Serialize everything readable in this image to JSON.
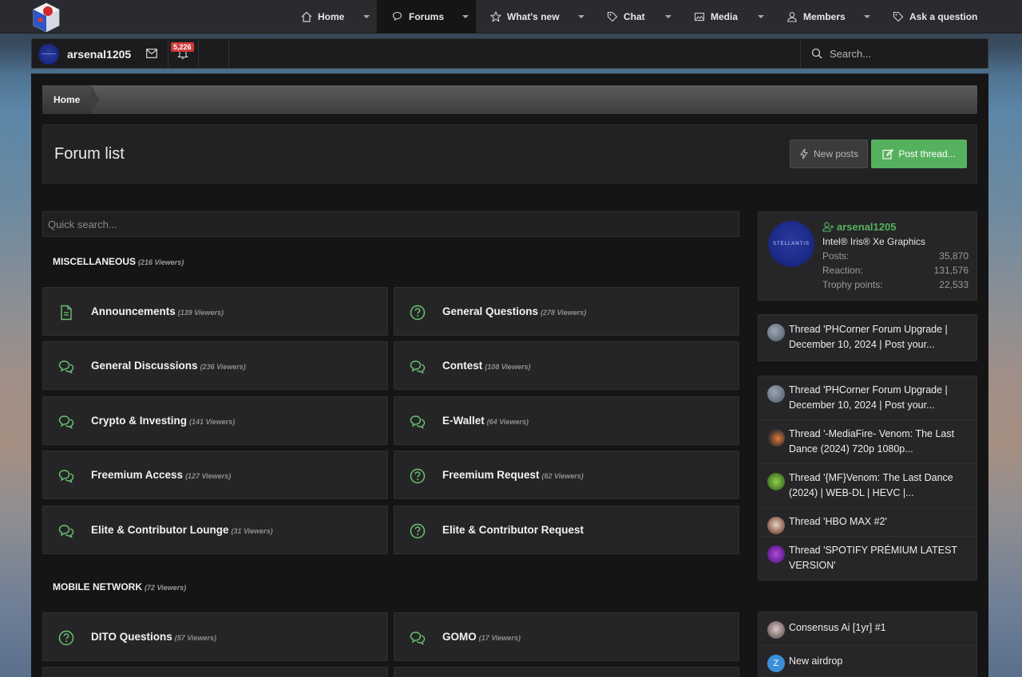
{
  "nav": {
    "items": [
      {
        "label": "Home",
        "icon": "home-icon"
      },
      {
        "label": "Forums",
        "icon": "forums-icon"
      },
      {
        "label": "What's new",
        "icon": "star-icon"
      },
      {
        "label": "Chat",
        "icon": "tag-icon"
      },
      {
        "label": "Media",
        "icon": "image-icon"
      },
      {
        "label": "Members",
        "icon": "user-icon"
      },
      {
        "label": "Ask a question",
        "icon": "tag-icon"
      }
    ]
  },
  "userbar": {
    "username": "arsenal1205",
    "alerts_count": "5,226",
    "search_placeholder": "Search..."
  },
  "breadcrumb": {
    "home": "Home"
  },
  "page": {
    "title": "Forum list",
    "new_posts_label": "New posts",
    "post_thread_label": "Post thread..."
  },
  "quick_search": {
    "placeholder": "Quick search..."
  },
  "categories": [
    {
      "name": "MISCELLANEOUS",
      "viewers": "(216 Viewers)",
      "forums": [
        {
          "name": "Announcements",
          "viewers": "(139 Viewers)",
          "icon": "document-icon"
        },
        {
          "name": "General Questions",
          "viewers": "(278 Viewers)",
          "icon": "question-icon"
        },
        {
          "name": "General Discussions",
          "viewers": "(236 Viewers)",
          "icon": "comments-icon"
        },
        {
          "name": "Contest",
          "viewers": "(108 Viewers)",
          "icon": "comments-icon"
        },
        {
          "name": "Crypto & Investing",
          "viewers": "(141 Viewers)",
          "icon": "comments-icon"
        },
        {
          "name": "E-Wallet",
          "viewers": "(64 Viewers)",
          "icon": "comments-icon"
        },
        {
          "name": "Freemium Access",
          "viewers": "(127 Viewers)",
          "icon": "comments-icon"
        },
        {
          "name": "Freemium Request",
          "viewers": "(62 Viewers)",
          "icon": "question-icon"
        },
        {
          "name": "Elite & Contributor Lounge",
          "viewers": "(31 Viewers)",
          "icon": "comments-icon"
        },
        {
          "name": "Elite & Contributor Request",
          "viewers": "",
          "icon": "question-icon"
        }
      ]
    },
    {
      "name": "MOBILE NETWORK",
      "viewers": "(72 Viewers)",
      "forums": [
        {
          "name": "DITO Questions",
          "viewers": "(57 Viewers)",
          "icon": "question-icon"
        },
        {
          "name": "GOMO",
          "viewers": "(17 Viewers)",
          "icon": "comments-icon"
        }
      ]
    }
  ],
  "profile": {
    "username": "arsenal1205",
    "avatar_text": "STELLANTIS",
    "title": "Intel® Iris® Xe Graphics",
    "stats": [
      {
        "label": "Posts:",
        "value": "35,870"
      },
      {
        "label": "Reaction:",
        "value": "131,576"
      },
      {
        "label": "Trophy points:",
        "value": "22,533"
      }
    ]
  },
  "activity_block1": [
    {
      "text": "Thread 'PHCorner Forum Upgrade | December 10, 2024 | Post your..."
    }
  ],
  "activity_block2": [
    {
      "text": "Thread 'PHCorner Forum Upgrade | December 10, 2024 | Post your..."
    },
    {
      "text": "Thread '-MediaFire- Venom: The Last Dance (2024) 720p 1080p..."
    },
    {
      "text": "Thread '{MF}Venom: The Last Dance (2024) | WEB-DL | HEVC |..."
    },
    {
      "text": "Thread 'HBO MAX #2'"
    },
    {
      "text": "Thread 'SPOTIFY PRÉMIUM LATEST VERSION'"
    }
  ],
  "activity_block3": [
    {
      "text": "Consensus Ai [1yr] #1"
    },
    {
      "text": "New airdrop"
    }
  ],
  "colors": {
    "accent_green": "#56b15e",
    "icon_green": "#6cc26f",
    "badge_red": "#d03a3a"
  }
}
